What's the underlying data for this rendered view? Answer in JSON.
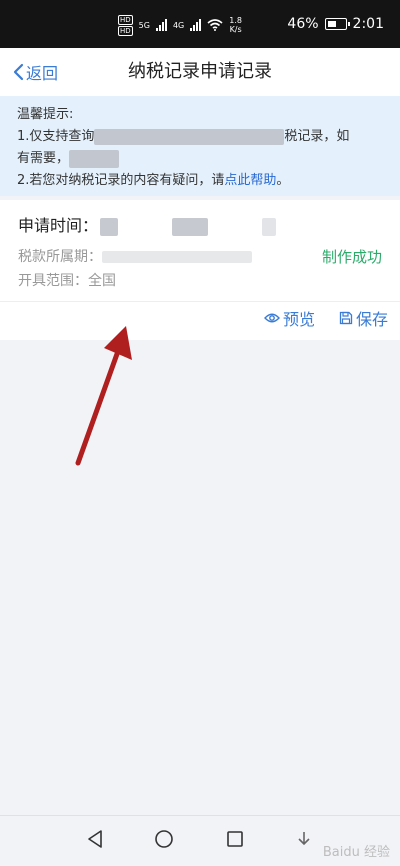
{
  "status_bar": {
    "hd1": "HD",
    "hd2": "HD",
    "net1": "5G",
    "net2": "4G",
    "speed_value": "1.8",
    "speed_unit": "K/s",
    "battery": "46%",
    "time": "2:01"
  },
  "nav": {
    "back_label": "返回",
    "title": "纳税记录申请记录"
  },
  "notice": {
    "heading": "温馨提示:",
    "line1_start": "1.仅支持查询",
    "line1_end": "税记录，如",
    "line2_start": "有需要，",
    "line3_start": "2.若您对纳税记录的内容有疑问，请",
    "help_link": "点此帮助",
    "line3_end": "。"
  },
  "record": {
    "time_label": "申请时间：",
    "period_label": "税款所属期：",
    "range_label": "开具范围：",
    "range_value": "全国",
    "status": "制作成功",
    "preview_label": "预览",
    "save_label": "保存"
  },
  "watermark": "Baidu 经验"
}
